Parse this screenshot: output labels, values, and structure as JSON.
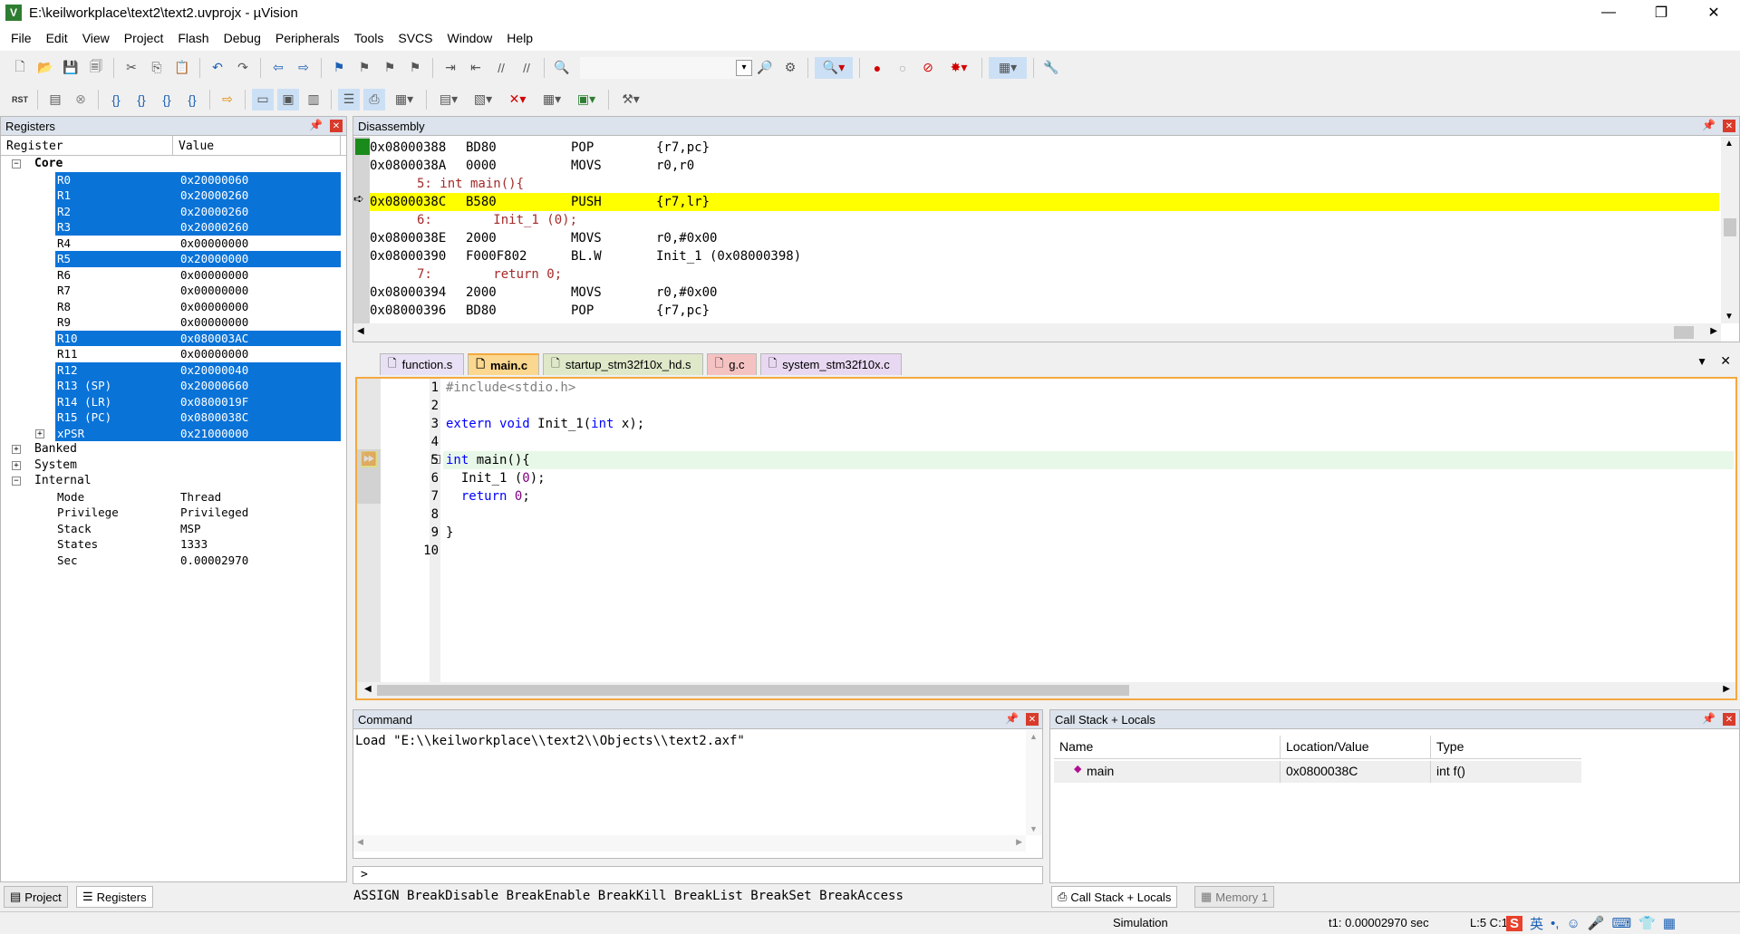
{
  "window": {
    "title": "E:\\keilworkplace\\text2\\text2.uvprojx - µVision",
    "minimize": "—",
    "maximize": "❐",
    "close": "✕"
  },
  "menu": [
    "File",
    "Edit",
    "View",
    "Project",
    "Flash",
    "Debug",
    "Peripherals",
    "Tools",
    "SVCS",
    "Window",
    "Help"
  ],
  "toolbar1_icons": [
    "new",
    "open",
    "save",
    "save-all",
    "cut",
    "copy",
    "paste",
    "undo",
    "redo",
    "back",
    "forward",
    "bookmark",
    "prev-bookmark",
    "next-bookmark",
    "clear-bookmark",
    "indent",
    "unindent",
    "comment",
    "uncomment",
    "find-in-files",
    "find",
    "debug-session",
    "breakpoint",
    "disabled-breakpoint",
    "kill-breakpoints",
    "clear-breakpoints",
    "window-layout",
    "configure"
  ],
  "toolbar2_icons": [
    "reset",
    "run",
    "stop",
    "step",
    "step-over",
    "step-out",
    "run-to-cursor",
    "show-next",
    "command-window",
    "disassembly-window",
    "symbols-window",
    "registers-window",
    "call-stack",
    "watch",
    "memory",
    "serial",
    "analysis",
    "trace",
    "system-viewer",
    "toolbox"
  ],
  "registers": {
    "title": "Registers",
    "col_register": "Register",
    "col_value": "Value",
    "group_core": "Core",
    "core": [
      {
        "name": "R0",
        "value": "0x20000060",
        "sel": true
      },
      {
        "name": "R1",
        "value": "0x20000260",
        "sel": true
      },
      {
        "name": "R2",
        "value": "0x20000260",
        "sel": true
      },
      {
        "name": "R3",
        "value": "0x20000260",
        "sel": true
      },
      {
        "name": "R4",
        "value": "0x00000000",
        "sel": false
      },
      {
        "name": "R5",
        "value": "0x20000000",
        "sel": true
      },
      {
        "name": "R6",
        "value": "0x00000000",
        "sel": false
      },
      {
        "name": "R7",
        "value": "0x00000000",
        "sel": false
      },
      {
        "name": "R8",
        "value": "0x00000000",
        "sel": false
      },
      {
        "name": "R9",
        "value": "0x00000000",
        "sel": false
      },
      {
        "name": "R10",
        "value": "0x080003AC",
        "sel": true
      },
      {
        "name": "R11",
        "value": "0x00000000",
        "sel": false
      },
      {
        "name": "R12",
        "value": "0x20000040",
        "sel": true
      },
      {
        "name": "R13 (SP)",
        "value": "0x20000660",
        "sel": true
      },
      {
        "name": "R14 (LR)",
        "value": "0x0800019F",
        "sel": true
      },
      {
        "name": "R15 (PC)",
        "value": "0x0800038C",
        "sel": true
      },
      {
        "name": "xPSR",
        "value": "0x21000000",
        "sel": true
      }
    ],
    "group_banked": "Banked",
    "group_system": "System",
    "group_internal": "Internal",
    "internal": [
      {
        "name": "Mode",
        "value": "Thread"
      },
      {
        "name": "Privilege",
        "value": "Privileged"
      },
      {
        "name": "Stack",
        "value": "MSP"
      },
      {
        "name": "States",
        "value": "1333"
      },
      {
        "name": "Sec",
        "value": "0.00002970"
      }
    ]
  },
  "disassembly": {
    "title": "Disassembly",
    "lines": [
      {
        "addr": "0x08000388",
        "op": "BD80",
        "mn": "POP",
        "args": "{r7,pc}",
        "kind": "asm"
      },
      {
        "addr": "0x0800038A",
        "op": "0000",
        "mn": "MOVS",
        "args": "r0,r0",
        "kind": "asm"
      },
      {
        "text": "5: int main(){",
        "kind": "src"
      },
      {
        "addr": "0x0800038C",
        "op": "B580",
        "mn": "PUSH",
        "args": "{r7,lr}",
        "kind": "cur"
      },
      {
        "text": "6:        Init_1 (0);",
        "kind": "src"
      },
      {
        "addr": "0x0800038E",
        "op": "2000",
        "mn": "MOVS",
        "args": "r0,#0x00",
        "kind": "asm"
      },
      {
        "addr": "0x08000390",
        "op": "F000F802",
        "mn": "BL.W",
        "args": "Init_1 (0x08000398)",
        "kind": "asm"
      },
      {
        "text": "7:        return 0;",
        "kind": "src"
      },
      {
        "addr": "0x08000394",
        "op": "2000",
        "mn": "MOVS",
        "args": "r0,#0x00",
        "kind": "asm"
      },
      {
        "addr": "0x08000396",
        "op": "BD80",
        "mn": "POP",
        "args": "{r7,pc}",
        "kind": "asm"
      }
    ]
  },
  "tabs": [
    {
      "label": "function.s",
      "active": false,
      "color": "#e8e0f4"
    },
    {
      "label": "main.c",
      "active": true,
      "color": "#fbd78f"
    },
    {
      "label": "startup_stm32f10x_hd.s",
      "active": false,
      "color": "#dfe8c9"
    },
    {
      "label": "g.c",
      "active": false,
      "color": "#f5c2c2"
    },
    {
      "label": "system_stm32f10x.c",
      "active": false,
      "color": "#e8d8f2"
    }
  ],
  "source": [
    {
      "n": "1",
      "code": "#include<stdio.h>"
    },
    {
      "n": "2",
      "code": ""
    },
    {
      "n": "3",
      "code": "extern void Init_1(int x);"
    },
    {
      "n": "4",
      "code": ""
    },
    {
      "n": "5",
      "code": "int main(){"
    },
    {
      "n": "6",
      "code": "  Init_1 (0);"
    },
    {
      "n": "7",
      "code": "  return 0;"
    },
    {
      "n": "8",
      "code": ""
    },
    {
      "n": "9",
      "code": "}"
    },
    {
      "n": "10",
      "code": ""
    }
  ],
  "command": {
    "title": "Command",
    "output": "Load \"E:\\\\keilworkplace\\\\text2\\\\Objects\\\\text2.axf\"",
    "prompt": ">",
    "hints": "ASSIGN BreakDisable BreakEnable BreakKill BreakList BreakSet BreakAccess"
  },
  "callstack": {
    "title": "Call Stack + Locals",
    "col_name": "Name",
    "col_loc": "Location/Value",
    "col_type": "Type",
    "rows": [
      {
        "name": "main",
        "loc": "0x0800038C",
        "type": "int f()"
      }
    ]
  },
  "bottom_tabs": {
    "project": "Project",
    "registers": "Registers",
    "callstack": "Call Stack + Locals",
    "memory": "Memory 1"
  },
  "status": {
    "mode": "Simulation",
    "time": "t1: 0.00002970 sec",
    "pos": "L:5 C:1"
  },
  "colors": {
    "accent": "#0a73d8",
    "highlight": "#ffff00",
    "keyword": "#0000ff",
    "number": "#800080",
    "include": "#808080",
    "src_line": "#a52a2a",
    "tab_active": "#f4a940"
  }
}
